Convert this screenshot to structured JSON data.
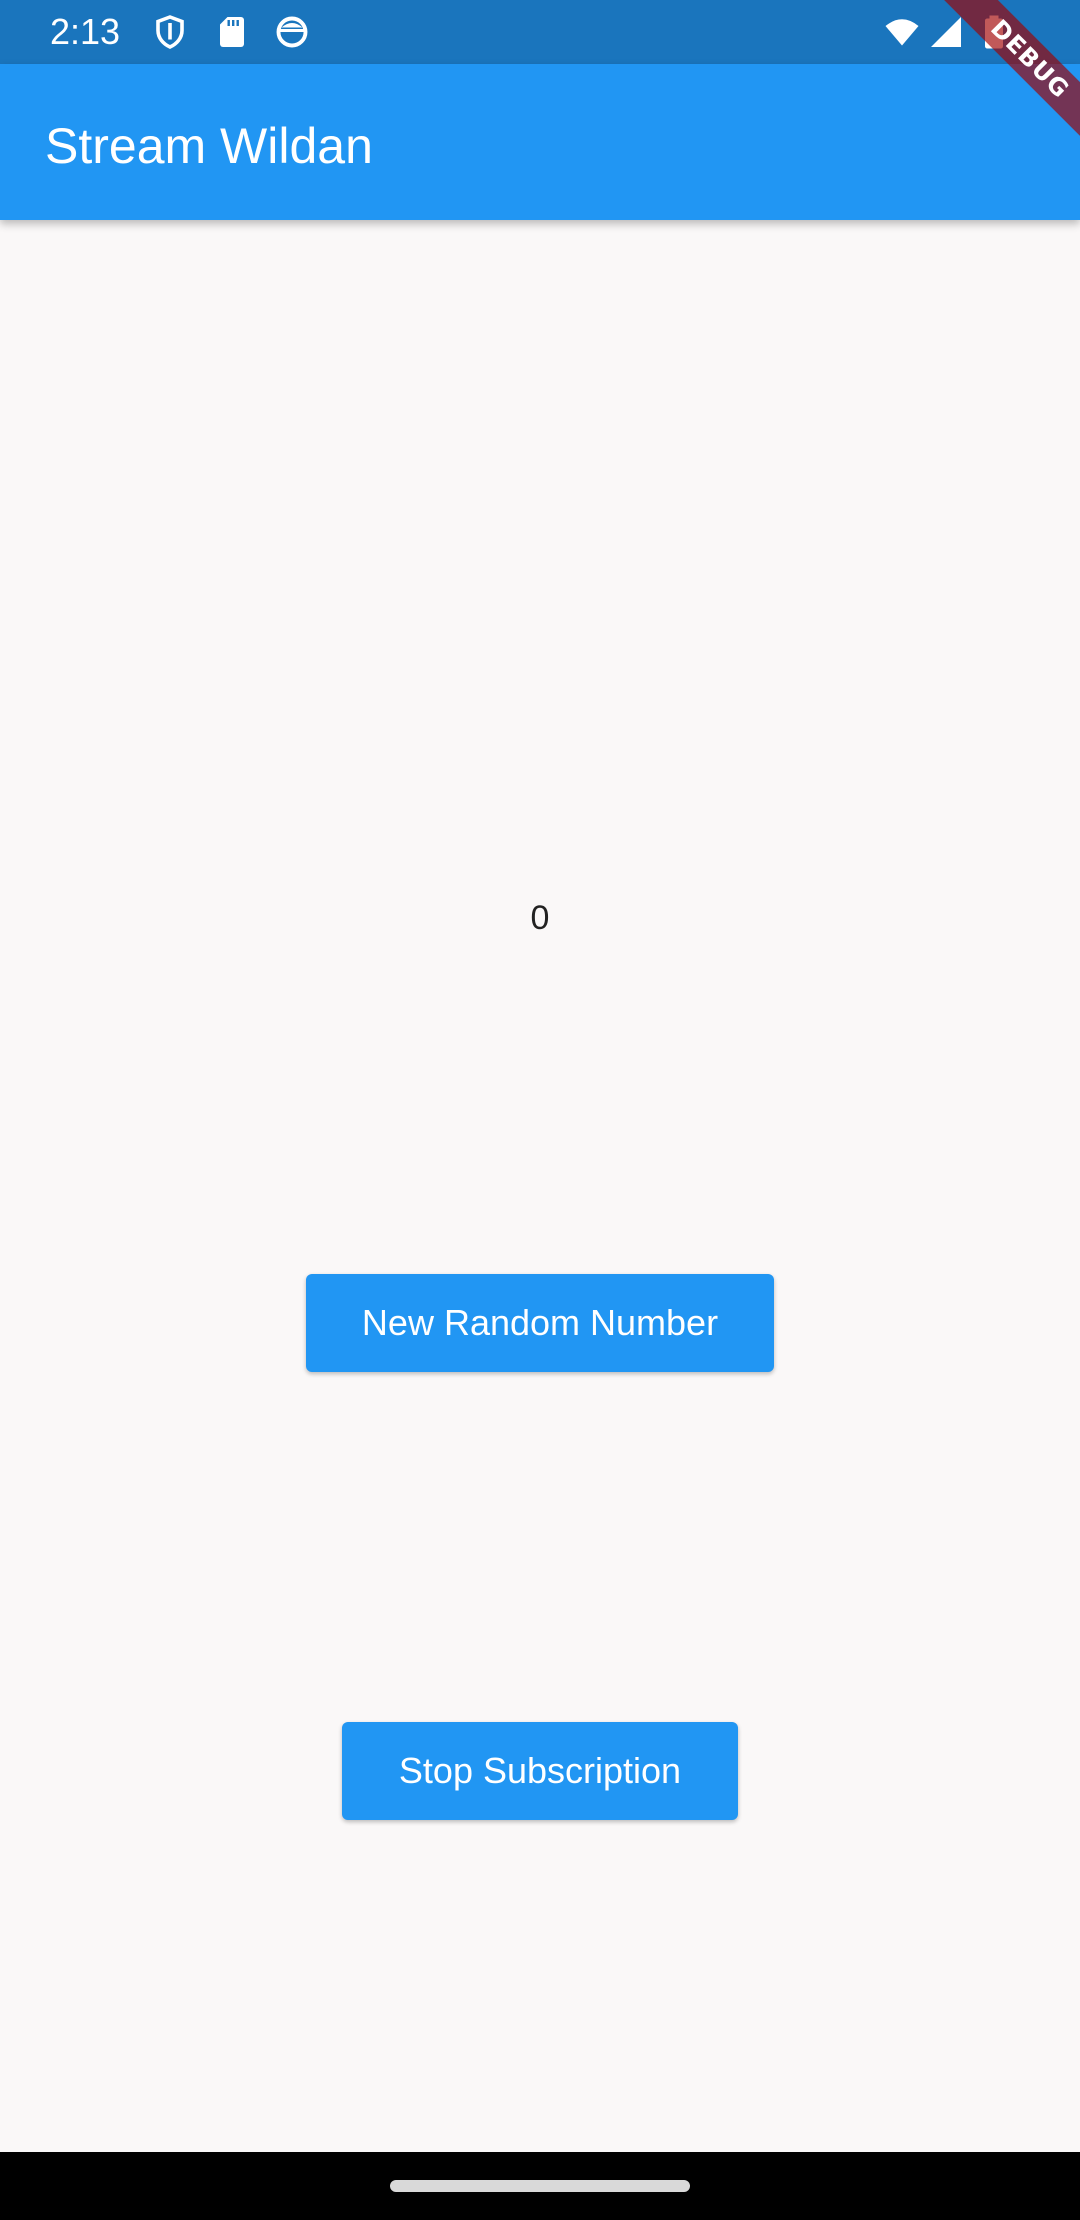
{
  "status_bar": {
    "time": "2:13",
    "icons": [
      "shield-icon",
      "sd-card-icon",
      "android-face-icon",
      "wifi-icon",
      "signal-icon",
      "battery-icon"
    ]
  },
  "app_bar": {
    "title": "Stream Wildan",
    "color": "#2196f3"
  },
  "debug_banner": {
    "label": "DEBUG"
  },
  "main": {
    "counter_value": "0",
    "new_random_button_label": "New Random Number",
    "stop_subscription_button_label": "Stop Subscription"
  },
  "theme": {
    "primary": "#2196f3",
    "status_bar": "#1a75bd",
    "background": "#faf8f8"
  }
}
